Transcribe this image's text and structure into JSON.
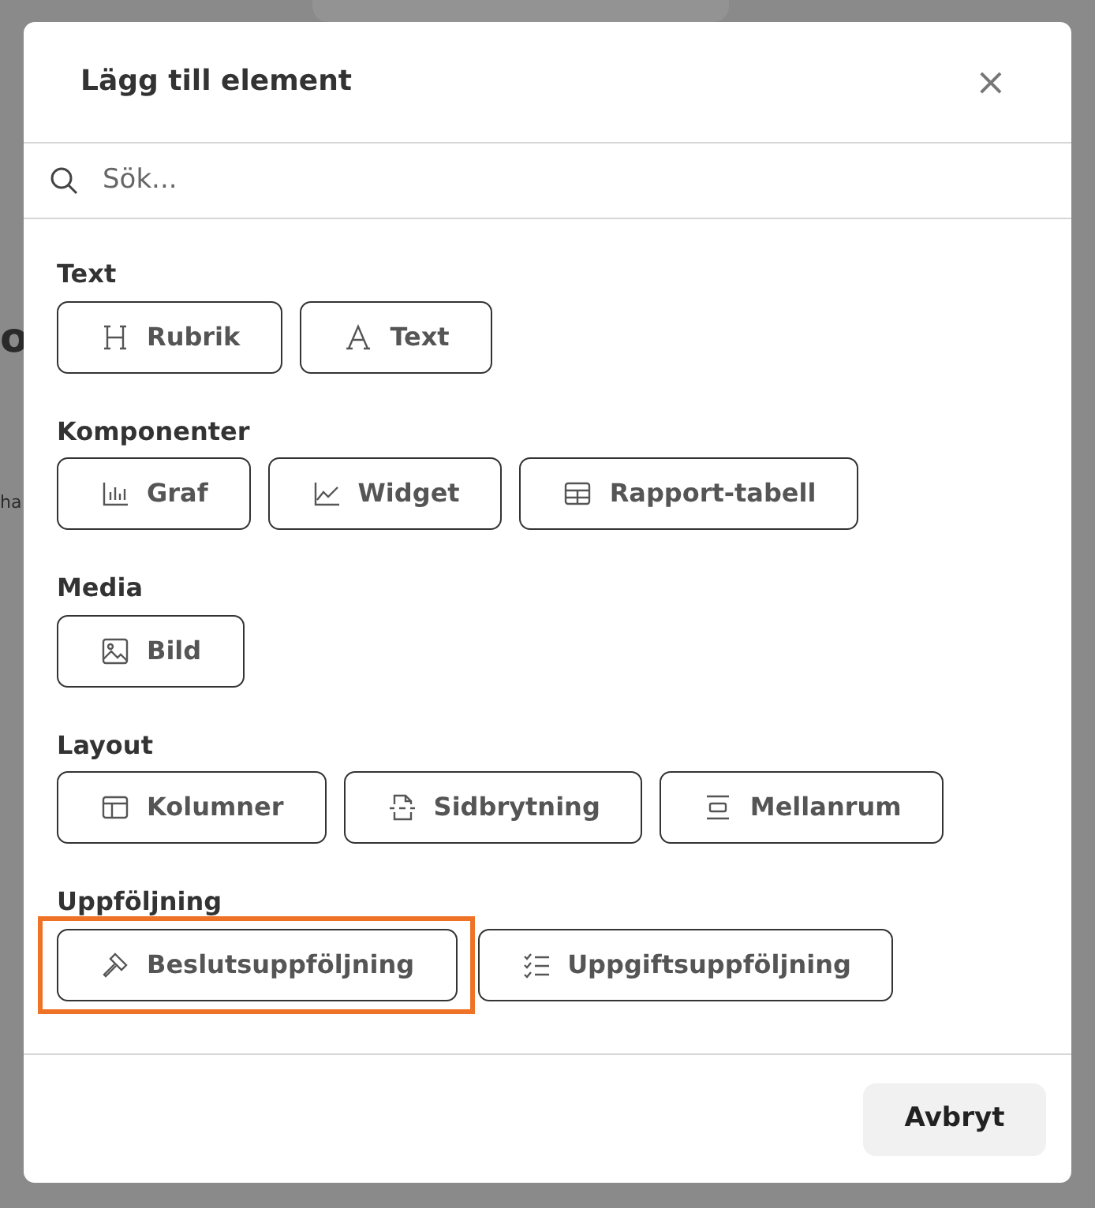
{
  "background_fragments": [
    {
      "text": "o",
      "kind": "heading"
    },
    {
      "text": "ha",
      "kind": "body"
    }
  ],
  "dialog": {
    "title": "Lägg till element",
    "close": "×",
    "search": {
      "placeholder": "Sök..."
    },
    "sections": [
      {
        "label": "Text",
        "items": [
          {
            "label": "Rubrik",
            "kind": "heading",
            "highlighted": false
          },
          {
            "label": "Text",
            "kind": "font",
            "highlighted": false
          }
        ]
      },
      {
        "label": "Komponenter",
        "items": [
          {
            "label": "Graf",
            "kind": "bars",
            "highlighted": false
          },
          {
            "label": "Widget",
            "kind": "line",
            "highlighted": false
          },
          {
            "label": "Rapport-tabell",
            "kind": "table",
            "highlighted": false
          }
        ]
      },
      {
        "label": "Media",
        "items": [
          {
            "label": "Bild",
            "kind": "image",
            "highlighted": false
          }
        ]
      },
      {
        "label": "Layout",
        "items": [
          {
            "label": "Kolumner",
            "kind": "columns",
            "highlighted": false
          },
          {
            "label": "Sidbrytning",
            "kind": "pagebreak",
            "highlighted": false
          },
          {
            "label": "Mellanrum",
            "kind": "spacing",
            "highlighted": false
          }
        ]
      },
      {
        "label": "Uppföljning",
        "items": [
          {
            "label": "Beslutsuppföljning",
            "kind": "gavel",
            "highlighted": true
          },
          {
            "label": "Uppgiftsuppföljning",
            "kind": "checklist",
            "highlighted": false
          }
        ]
      }
    ],
    "buttons": [
      "Avbryt"
    ]
  }
}
